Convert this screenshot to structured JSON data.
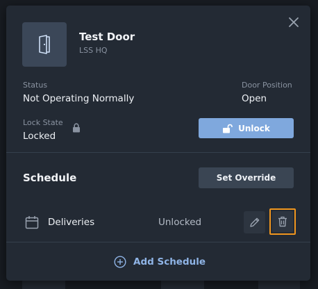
{
  "door": {
    "name": "Test Door",
    "site": "LSS HQ"
  },
  "status": {
    "status_label": "Status",
    "status_value": "Not Operating Normally",
    "position_label": "Door Position",
    "position_value": "Open",
    "lock_label": "Lock State",
    "lock_value": "Locked"
  },
  "actions": {
    "unlock_label": "Unlock"
  },
  "schedule": {
    "title": "Schedule",
    "override_label": "Set Override",
    "items": [
      {
        "name": "Deliveries",
        "state": "Unlocked"
      }
    ],
    "add_label": "Add Schedule"
  },
  "colors": {
    "accent": "#7fa8dd",
    "highlight_outline": "#f0961e",
    "status_dot": "#e3c11a"
  },
  "icons": {
    "close": "close-icon",
    "door": "door-icon",
    "lock": "lock-icon",
    "unlock": "unlock-icon",
    "calendar": "calendar-icon",
    "edit": "pencil-icon",
    "delete": "trash-icon",
    "add": "plus-circle-icon"
  }
}
